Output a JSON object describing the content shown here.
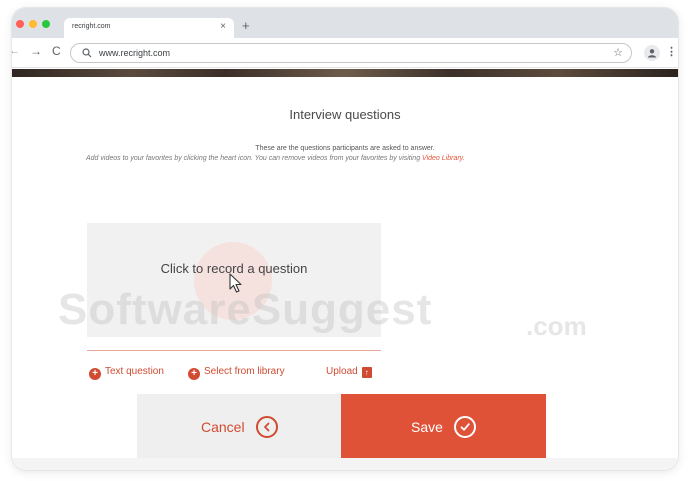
{
  "browser": {
    "tab_title": "recright.com",
    "tab_close": "×",
    "new_tab": "+",
    "url": "www.recright.com",
    "star": "☆",
    "menu": "⋮",
    "back": "←",
    "forward": "→",
    "reload": "C"
  },
  "page": {
    "title": "Interview questions",
    "description": "These are the questions participants are asked to answer.",
    "favorites_hint": "Add videos to your favorites by clicking the heart icon. You can remove videos from your favorites by visiting",
    "favorites_link": "Video Library",
    "favorites_period": ".",
    "recorder_label": "Click to record a question",
    "options": {
      "text_question": "Text question",
      "select_library": "Select from library",
      "upload": "Upload"
    },
    "cancel_label": "Cancel",
    "save_label": "Save"
  },
  "watermark": {
    "main": "SoftwareSuggest",
    "suffix": ".com"
  },
  "colors": {
    "accent": "#df5238",
    "accent_text": "#d04b32"
  }
}
